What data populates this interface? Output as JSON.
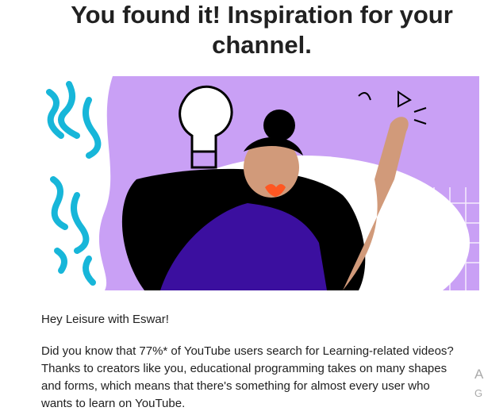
{
  "header": {
    "title": "You found it! Inspiration for your channel."
  },
  "hero": {
    "image": "illustration-woman-lightbulb",
    "colors": {
      "background": "#c9a0f5",
      "teal": "#17b6d9",
      "shirt": "#3b0f9f",
      "skin": "#d19a7a"
    }
  },
  "email": {
    "greeting": "Hey Leisure with Eswar!",
    "paragraph": "Did you know that 77%* of YouTube users search for Learning-related videos? Thanks to creators like you, educational programming takes on many shapes and forms, which means that there's something for almost every user who wants to learn on YouTube."
  },
  "side_cut": {
    "a": "A",
    "g": "G"
  }
}
